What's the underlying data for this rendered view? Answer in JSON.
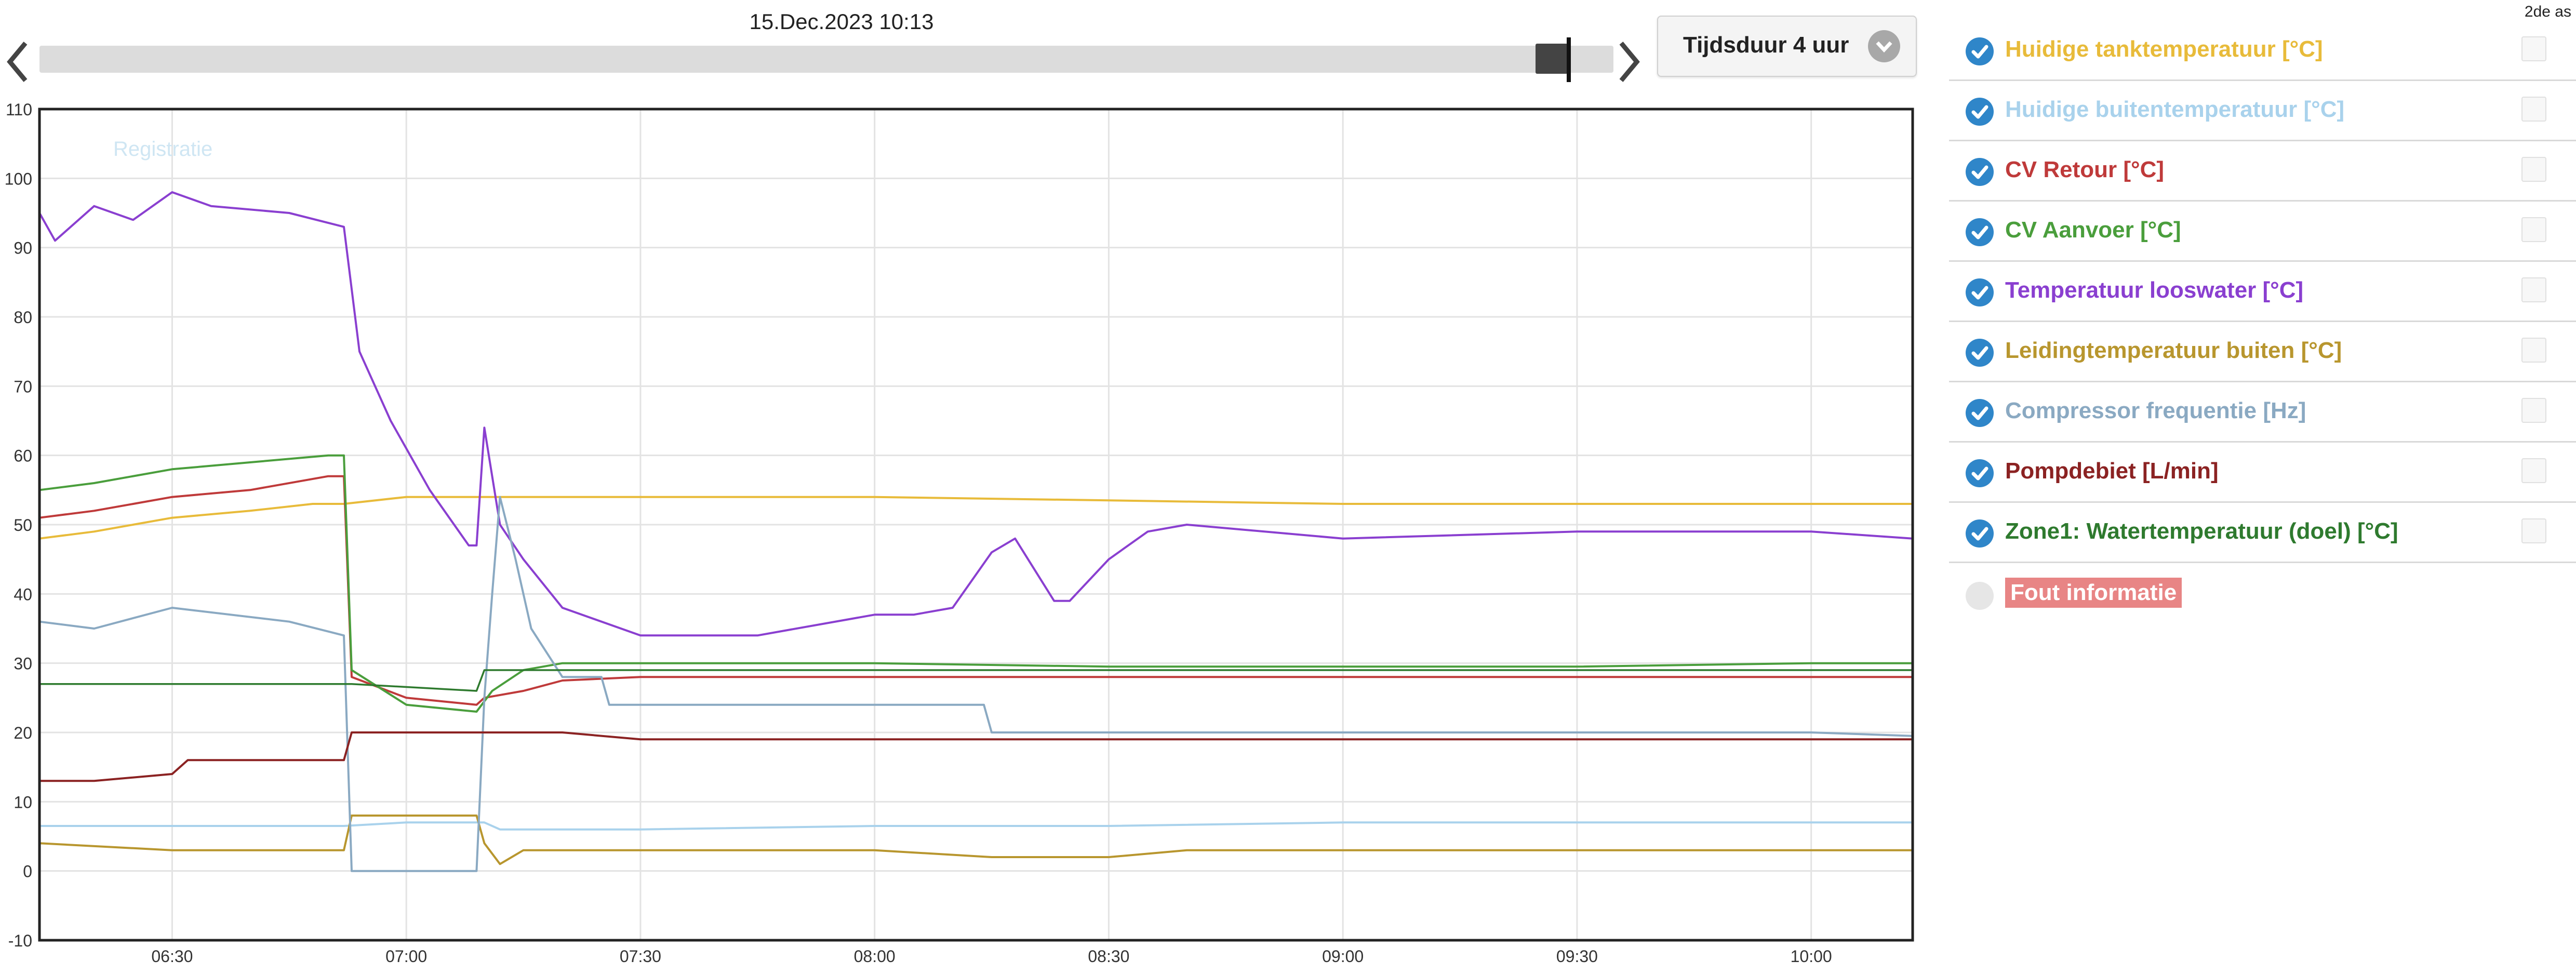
{
  "header": {
    "date": "15.Dec.2023 10:13",
    "duration_label": "Tijdsduur 4 uur",
    "second_axis_label": "2de as"
  },
  "colors": {
    "tank": "#e8bb3a",
    "outside": "#a9d2ec",
    "cv_retour": "#bf3a3a",
    "cv_aanvoer": "#4a9e3c",
    "looswater": "#8a3fd0",
    "leiding": "#b8962e",
    "compressor": "#8aa9c2",
    "pomp": "#8b2222",
    "zone1": "#2e7a2e",
    "check": "#2f86c9",
    "error_bg": "#e88585"
  },
  "legend": {
    "items": [
      {
        "label": "Huidige tanktemperatuur [°C]",
        "color": "#e8bb3a",
        "checked": true
      },
      {
        "label": "Huidige buitentemperatuur [°C]",
        "color": "#a9d2ec",
        "checked": true
      },
      {
        "label": "CV Retour [°C]",
        "color": "#bf3a3a",
        "checked": true
      },
      {
        "label": "CV Aanvoer [°C]",
        "color": "#4a9e3c",
        "checked": true
      },
      {
        "label": "Temperatuur looswater [°C]",
        "color": "#8a3fd0",
        "checked": true
      },
      {
        "label": "Leidingtemperatuur buiten [°C]",
        "color": "#b8962e",
        "checked": true
      },
      {
        "label": "Compressor frequentie [Hz]",
        "color": "#8aa9c2",
        "checked": true
      },
      {
        "label": "Pompdebiet [L/min]",
        "color": "#8b2222",
        "checked": true
      },
      {
        "label": "Zone1: Watertemperatuur (doel) [°C]",
        "color": "#2e7a2e",
        "checked": true
      }
    ],
    "error_label": "Fout informatie"
  },
  "chart_data": {
    "type": "line",
    "watermark": "Registratie",
    "x_ticks": [
      "06:30",
      "07:00",
      "07:30",
      "08:00",
      "08:30",
      "09:00",
      "09:30",
      "10:00"
    ],
    "xlim": [
      "06:13",
      "10:13"
    ],
    "ylim": [
      -10,
      110
    ],
    "y_ticks": [
      -10,
      0,
      10,
      20,
      30,
      40,
      50,
      60,
      70,
      80,
      90,
      100,
      110
    ],
    "grid": true,
    "series": [
      {
        "name": "Huidige tanktemperatuur [°C]",
        "color": "#e8bb3a",
        "width": 4,
        "x": [
          "06:13",
          "06:20",
          "06:25",
          "06:30",
          "06:40",
          "06:48",
          "06:52",
          "07:00",
          "07:30",
          "08:00",
          "08:30",
          "09:00",
          "09:30",
          "10:00",
          "10:13"
        ],
        "y": [
          48,
          49,
          50,
          51,
          52,
          53,
          53,
          54,
          54,
          54,
          53.5,
          53,
          53,
          53,
          53
        ]
      },
      {
        "name": "Huidige buitentemperatuur [°C]",
        "color": "#a9d2ec",
        "width": 4,
        "x": [
          "06:13",
          "06:30",
          "06:52",
          "07:00",
          "07:10",
          "07:12",
          "07:30",
          "08:00",
          "08:30",
          "09:00",
          "09:30",
          "10:00",
          "10:13"
        ],
        "y": [
          6.5,
          6.5,
          6.5,
          7,
          7,
          6,
          6,
          6.5,
          6.5,
          7,
          7,
          7,
          7
        ]
      },
      {
        "name": "CV Retour [°C]",
        "color": "#bf3a3a",
        "width": 4,
        "x": [
          "06:13",
          "06:20",
          "06:30",
          "06:40",
          "06:50",
          "06:52",
          "06:53",
          "07:00",
          "07:09",
          "07:10",
          "07:15",
          "07:20",
          "07:30",
          "08:00",
          "08:30",
          "09:00",
          "09:30",
          "10:00",
          "10:13"
        ],
        "y": [
          51,
          52,
          54,
          55,
          57,
          57,
          28,
          25,
          24,
          25,
          26,
          27.5,
          28,
          28,
          28,
          28,
          28,
          28,
          28
        ]
      },
      {
        "name": "CV Aanvoer [°C]",
        "color": "#4a9e3c",
        "width": 4,
        "x": [
          "06:13",
          "06:20",
          "06:30",
          "06:40",
          "06:50",
          "06:52",
          "06:53",
          "07:00",
          "07:09",
          "07:11",
          "07:15",
          "07:20",
          "07:30",
          "08:00",
          "08:30",
          "09:00",
          "09:30",
          "10:00",
          "10:13"
        ],
        "y": [
          55,
          56,
          58,
          59,
          60,
          60,
          29,
          24,
          23,
          26,
          29,
          30,
          30,
          30,
          29.5,
          29.5,
          29.5,
          30,
          30
        ]
      },
      {
        "name": "Temperatuur looswater [°C]",
        "color": "#8a3fd0",
        "width": 4,
        "x": [
          "06:13",
          "06:15",
          "06:20",
          "06:25",
          "06:30",
          "06:35",
          "06:45",
          "06:52",
          "06:54",
          "06:58",
          "07:03",
          "07:08",
          "07:09",
          "07:10",
          "07:12",
          "07:15",
          "07:20",
          "07:30",
          "07:45",
          "08:00",
          "08:05",
          "08:10",
          "08:15",
          "08:18",
          "08:23",
          "08:25",
          "08:30",
          "08:35",
          "08:40",
          "09:00",
          "09:30",
          "10:00",
          "10:13"
        ],
        "y": [
          95,
          91,
          96,
          94,
          98,
          96,
          95,
          93,
          75,
          65,
          55,
          47,
          47,
          64,
          50,
          45,
          38,
          34,
          34,
          37,
          37,
          38,
          46,
          48,
          39,
          39,
          45,
          49,
          50,
          48,
          49,
          49,
          48
        ]
      },
      {
        "name": "Leidingtemperatuur buiten [°C]",
        "color": "#b8962e",
        "width": 4,
        "x": [
          "06:13",
          "06:30",
          "06:52",
          "06:53",
          "07:09",
          "07:10",
          "07:12",
          "07:15",
          "07:30",
          "08:00",
          "08:15",
          "08:30",
          "08:40",
          "09:00",
          "09:30",
          "10:00",
          "10:13"
        ],
        "y": [
          4,
          3,
          3,
          8,
          8,
          4,
          1,
          3,
          3,
          3,
          2,
          2,
          3,
          3,
          3,
          3,
          3
        ]
      },
      {
        "name": "Compressor frequentie [Hz]",
        "color": "#8aa9c2",
        "width": 4,
        "x": [
          "06:13",
          "06:20",
          "06:30",
          "06:45",
          "06:52",
          "06:53",
          "07:09",
          "07:10",
          "07:11",
          "07:12",
          "07:14",
          "07:16",
          "07:20",
          "07:25",
          "07:26",
          "08:00",
          "08:14",
          "08:15",
          "08:30",
          "09:00",
          "09:30",
          "10:00",
          "10:13"
        ],
        "y": [
          36,
          35,
          38,
          36,
          34,
          0,
          0,
          25,
          40,
          54,
          45,
          35,
          28,
          28,
          24,
          24,
          24,
          20,
          20,
          20,
          20,
          20,
          19.5
        ]
      },
      {
        "name": "Pompdebiet [L/min]",
        "color": "#8b2222",
        "width": 4,
        "x": [
          "06:13",
          "06:20",
          "06:30",
          "06:32",
          "06:45",
          "06:52",
          "06:53",
          "07:00",
          "07:10",
          "07:20",
          "07:30",
          "08:00",
          "08:30",
          "09:00",
          "09:30",
          "10:00",
          "10:13"
        ],
        "y": [
          13,
          13,
          14,
          16,
          16,
          16,
          20,
          20,
          20,
          20,
          19,
          19,
          19,
          19,
          19,
          19,
          19
        ]
      },
      {
        "name": "Zone1: Watertemperatuur (doel) [°C]",
        "color": "#2e7a2e",
        "width": 3.5,
        "x": [
          "06:13",
          "06:52",
          "06:53",
          "07:09",
          "07:10",
          "07:30",
          "08:00",
          "08:30",
          "09:00",
          "09:30",
          "10:00",
          "10:13"
        ],
        "y": [
          27,
          27,
          27,
          26,
          29,
          29,
          29,
          29,
          29,
          29,
          29,
          29
        ]
      }
    ]
  }
}
